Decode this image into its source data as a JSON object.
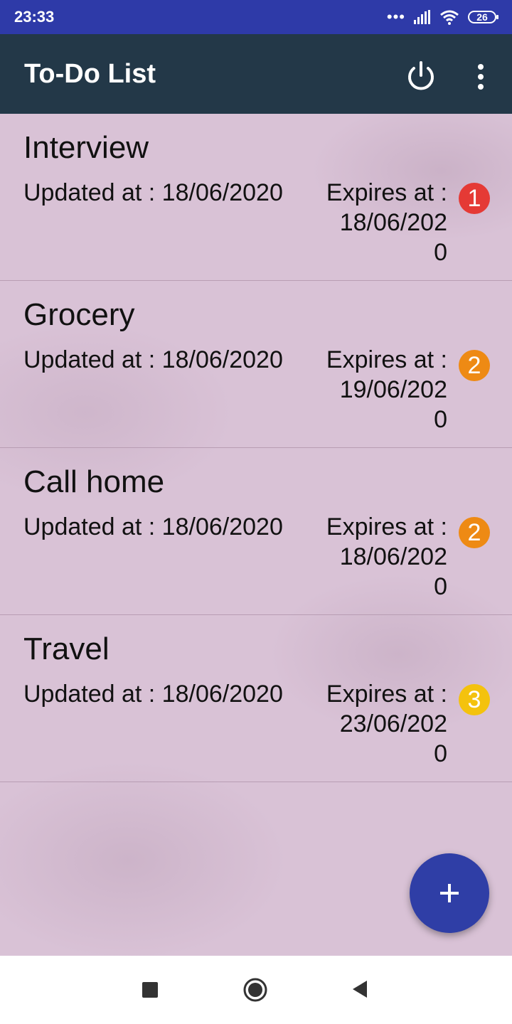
{
  "status_bar": {
    "time": "23:33",
    "battery": "26"
  },
  "app_bar": {
    "title": "To-Do List"
  },
  "tasks": [
    {
      "title": "Interview",
      "updated_label": "Updated at : 18/06/2020",
      "expires_label": "Expires at :",
      "expires_line1": "18/06/202",
      "expires_line2": "0",
      "priority": "1",
      "priority_color": "#e53a35"
    },
    {
      "title": "Grocery",
      "updated_label": "Updated at : 18/06/2020",
      "expires_label": "Expires at :",
      "expires_line1": "19/06/202",
      "expires_line2": "0",
      "priority": "2",
      "priority_color": "#ee8a14"
    },
    {
      "title": "Call home",
      "updated_label": "Updated at : 18/06/2020",
      "expires_label": "Expires at :",
      "expires_line1": "18/06/202",
      "expires_line2": "0",
      "priority": "2",
      "priority_color": "#ee8a14"
    },
    {
      "title": "Travel",
      "updated_label": "Updated at : 18/06/2020",
      "expires_label": "Expires at :",
      "expires_line1": "23/06/202",
      "expires_line2": "0",
      "priority": "3",
      "priority_color": "#f4c20d"
    }
  ],
  "colors": {
    "status_bar": "#2e3aa8",
    "app_bar": "#233848",
    "fab": "#2f3ea6"
  },
  "icons": {
    "app_bar_actions": [
      "power-icon",
      "more-vert-icon"
    ],
    "fab": "add-icon",
    "nav": [
      "recents-icon",
      "home-icon",
      "back-icon"
    ]
  }
}
